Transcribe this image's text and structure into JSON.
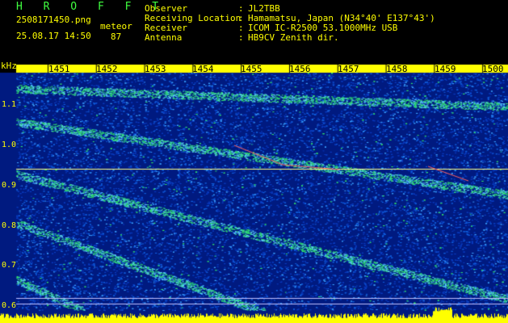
{
  "header": {
    "app_title": "H R O F F T",
    "filename": "2508171450.png",
    "datetime": "25.08.17 14:50",
    "counter_label": "meteor",
    "counter_value": "87",
    "fields": [
      {
        "label": "Observer",
        "value": "JL2TBB"
      },
      {
        "label": "Receiving Location",
        "value": "Hamamatsu, Japan (N34°40' E137°43')"
      },
      {
        "label": "Receiver",
        "value": "ICOM IC-R2500 53.1000MHz USB"
      },
      {
        "label": "Antenna",
        "value": "HB9CV Zenith dir."
      }
    ]
  },
  "spectrogram": {
    "y_unit": "kHz",
    "y_ticks": [
      "1.1",
      "1.0",
      "0.9",
      "0.8",
      "0.7",
      "0.6"
    ],
    "x_ticks": [
      "1451",
      "1452",
      "1453",
      "1454",
      "1455",
      "1456",
      "1457",
      "1458",
      "1459",
      "1500"
    ],
    "colors": {
      "background": "#001a80",
      "noise_mid": "#1060e0",
      "signal": "#30e070",
      "carrier_line": "#ffff80",
      "meteor_trail": "#ff6060",
      "level_bar": "#ffff00",
      "tick_marks": "#ffff00"
    }
  }
}
